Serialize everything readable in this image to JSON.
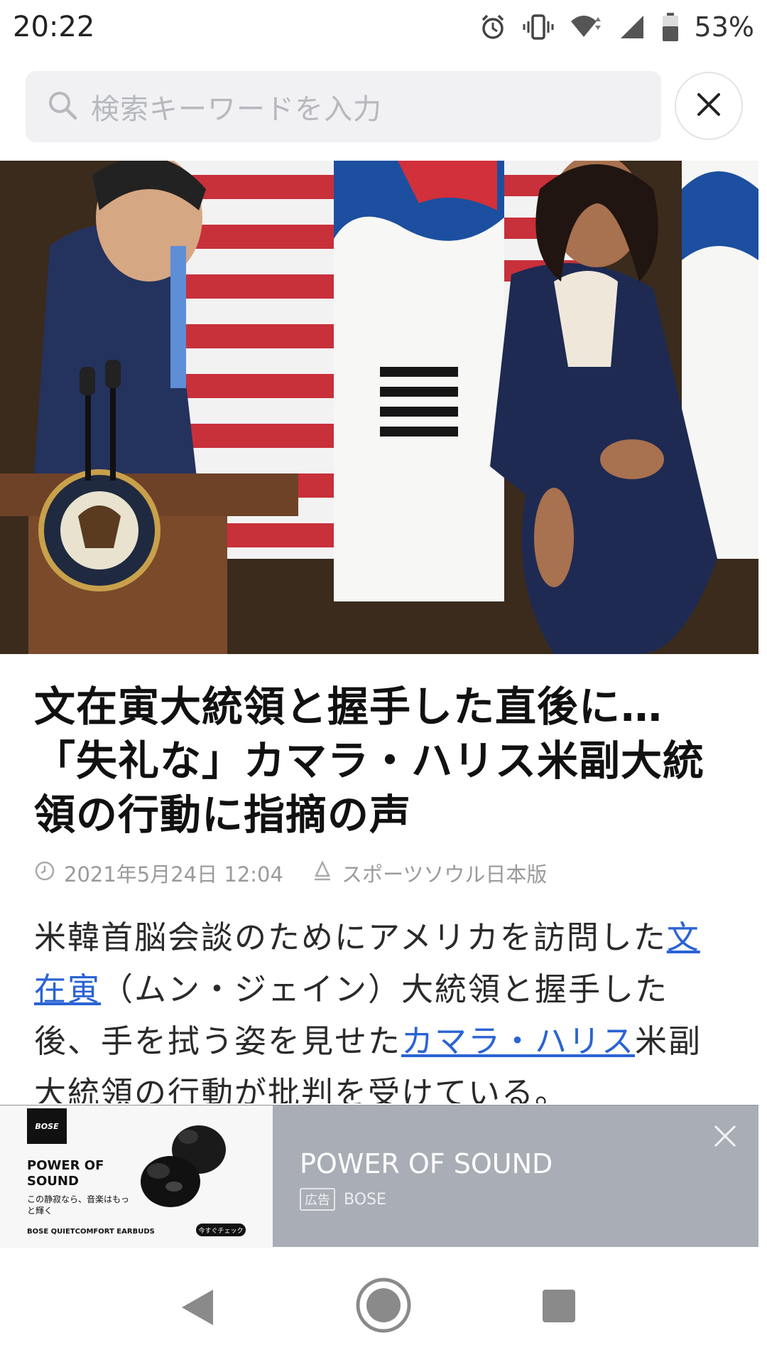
{
  "status_bar": {
    "time": "20:22",
    "battery": "53%",
    "icons": [
      "alarm-icon",
      "vibrate-icon",
      "wifi-icon",
      "cell-signal-icon",
      "battery-icon"
    ]
  },
  "search": {
    "placeholder": "検索キーワードを入力"
  },
  "article": {
    "title": "文在寅大統領と握手した直後に…「失礼な」カマラ・ハリス米副大統領の行動に指摘の声",
    "date": "2021年5月24日 12:04",
    "source": "スポーツソウル日本版",
    "body": {
      "part1": "米韓首脳会談のためにアメリカを訪問した",
      "link1": "文在寅",
      "part2": "（ムン・ジェイン）大統領と握手した後、手を拭う姿を見せた",
      "link2": "カマラ・ハリス",
      "part3": "米副大統領の行動が批判を受けている。"
    }
  },
  "ad": {
    "headline": "POWER OF SOUND",
    "badge": "広告",
    "sponsor": "BOSE",
    "image": {
      "logo": "BOSE",
      "title": "POWER OF SOUND",
      "subtitle": "この静寂なら、音楽はもっと輝く",
      "product": "BOSE QUIETCOMFORT EARBUDS",
      "cta": "今すぐチェック"
    }
  },
  "colors": {
    "link": "#2a63d4",
    "ad_background": "#a9adb5",
    "search_background": "#f1f1f3"
  }
}
